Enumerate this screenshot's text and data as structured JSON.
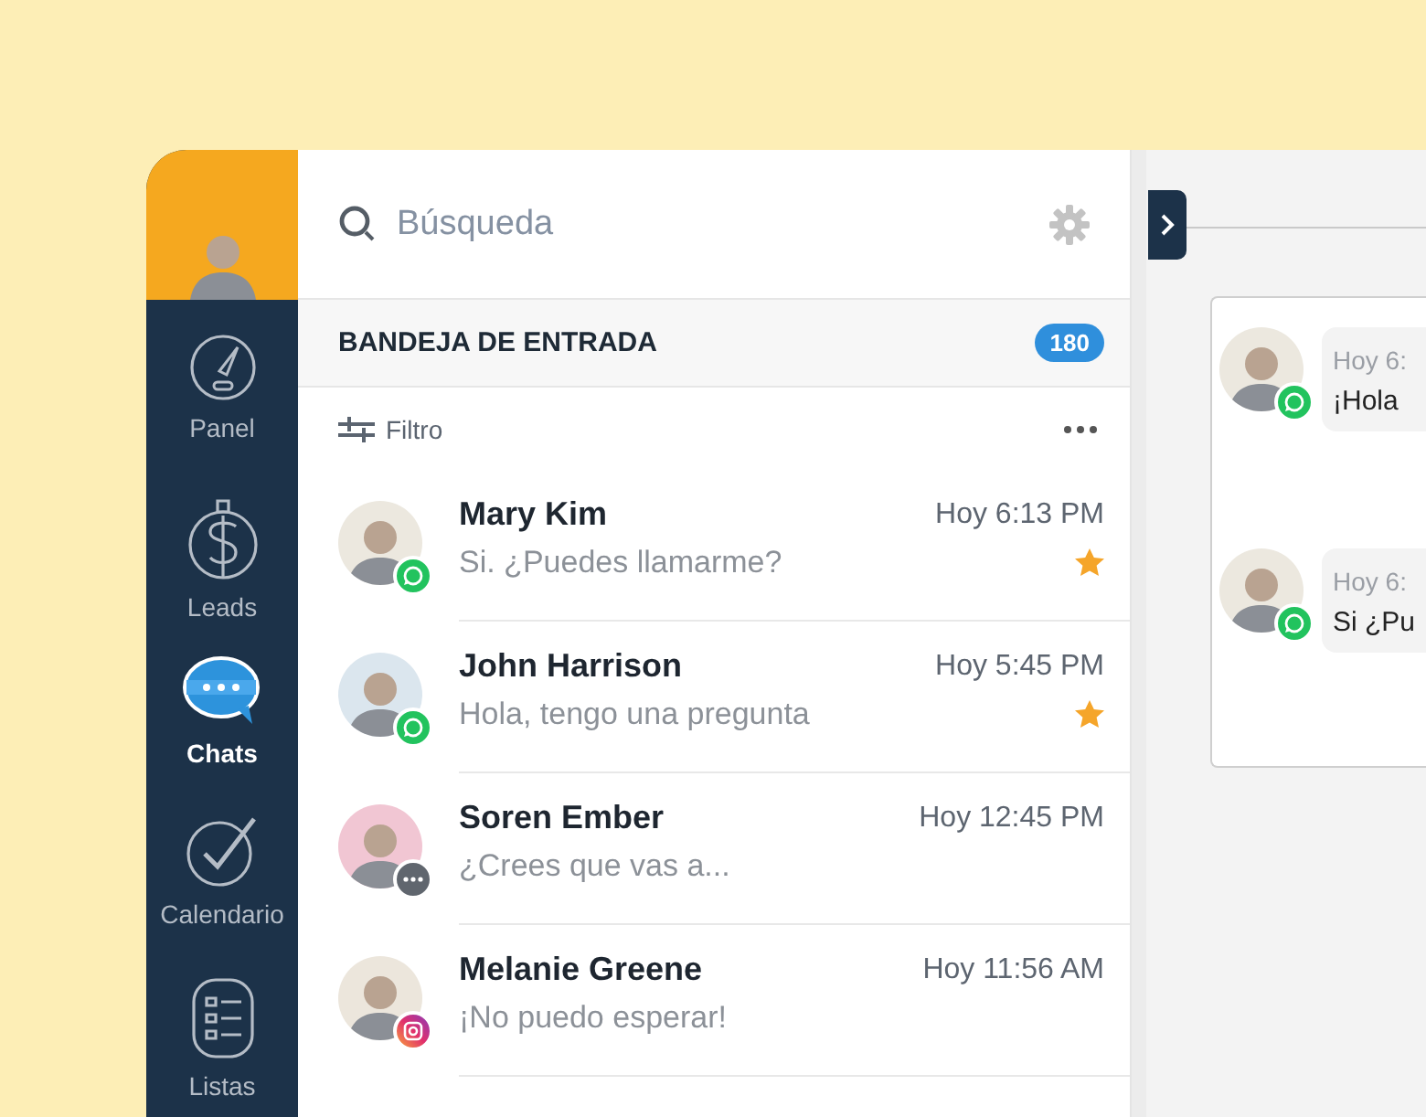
{
  "sidebar": {
    "items": [
      {
        "label": "Panel",
        "selected": false
      },
      {
        "label": "Leads",
        "selected": false
      },
      {
        "label": "Chats",
        "selected": true
      },
      {
        "label": "Calendario",
        "selected": false
      },
      {
        "label": "Listas",
        "selected": false
      }
    ]
  },
  "search": {
    "placeholder": "Búsqueda"
  },
  "inbox": {
    "title": "BANDEJA DE ENTRADA",
    "count": "180"
  },
  "filter": {
    "label": "Filtro"
  },
  "conversations": [
    {
      "name": "Mary Kim",
      "message": "Si. ¿Puedes llamarme?",
      "time": "Hoy 6:13 PM",
      "kind": "whatsapp",
      "starred": true
    },
    {
      "name": "John Harrison",
      "message": "Hola, tengo una pregunta",
      "time": "Hoy 5:45 PM",
      "kind": "whatsapp",
      "starred": true
    },
    {
      "name": "Soren Ember",
      "message": "¿Crees que vas a...",
      "time": "Hoy 12:45 PM",
      "kind": "chat",
      "starred": false
    },
    {
      "name": "Melanie Greene",
      "message": "¡No puedo esperar!",
      "time": "Hoy 11:56 AM",
      "kind": "instagram",
      "starred": false
    }
  ],
  "chat": {
    "messages": [
      {
        "time": "Hoy 6:",
        "text": "¡Hola",
        "kind": "whatsapp"
      },
      {
        "time": "Hoy 6:",
        "text": "Si ¿Pu",
        "kind": "whatsapp"
      }
    ]
  }
}
